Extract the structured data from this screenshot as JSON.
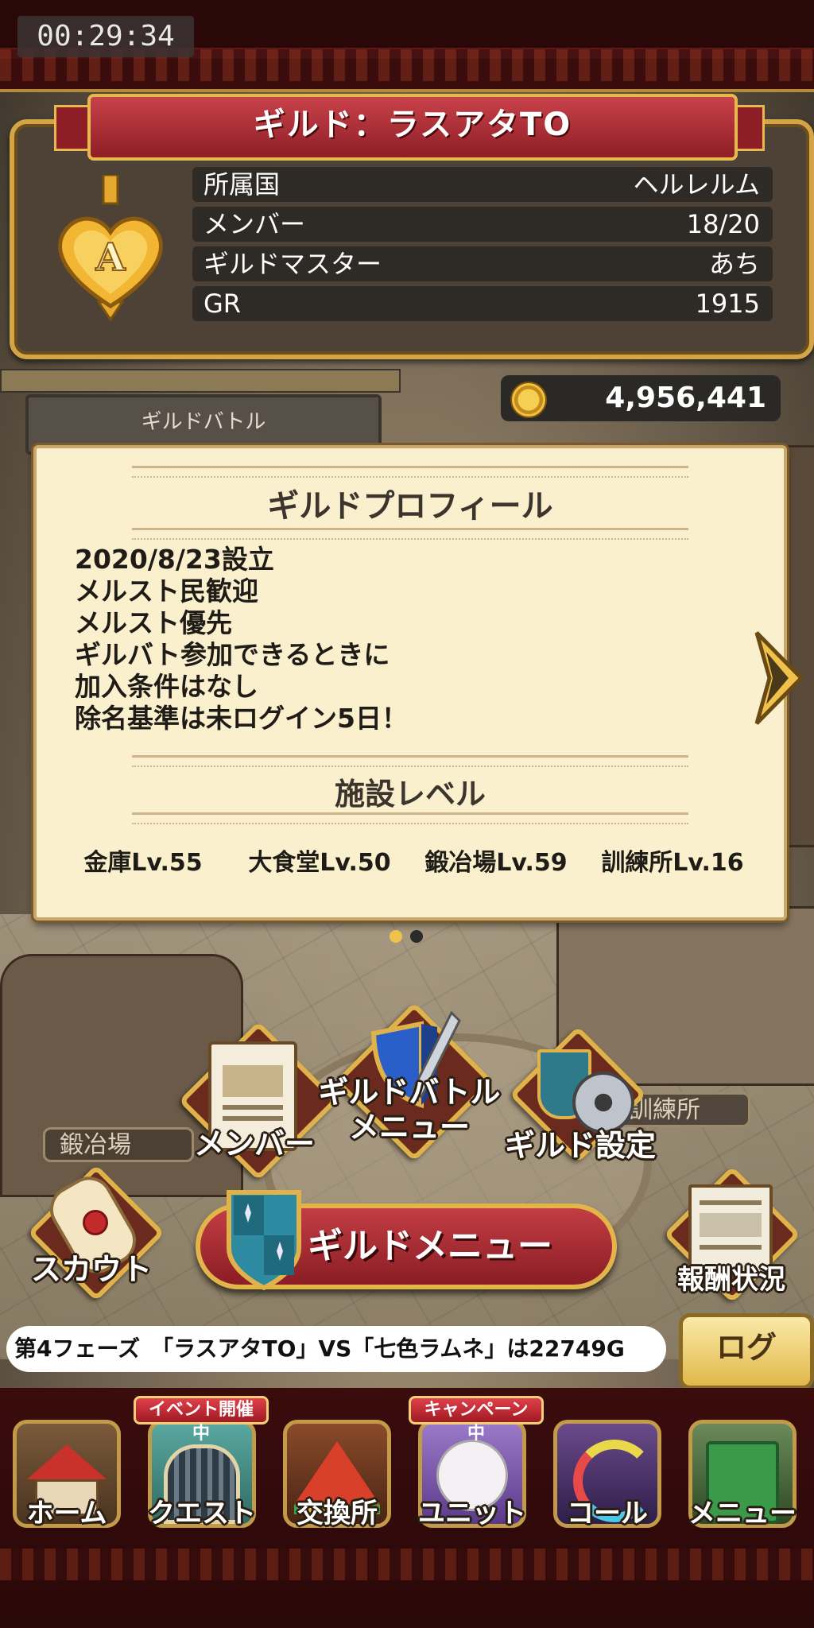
{
  "status": {
    "timer": "00:29:34"
  },
  "guild": {
    "title": "ギルド：ラスアタTO",
    "emblem_letter": "A",
    "info": [
      {
        "key": "所属国",
        "value": "ヘルレルム"
      },
      {
        "key": "メンバー",
        "value": "18/20"
      },
      {
        "key": "ギルドマスター",
        "value": "あち"
      },
      {
        "key": "GR",
        "value": "1915"
      }
    ]
  },
  "gold": "4,956,441",
  "battle_sign": "ギルドバトル",
  "profile": {
    "title": "ギルドプロフィール",
    "lines": [
      "2020/8/23設立",
      "メルスト民歓迎",
      "メルスト優先",
      "ギルバト参加できるときに",
      "加入条件はなし",
      "除名基準は未ログイン5日！"
    ],
    "facility_title": "施設レベル",
    "facilities": [
      "金庫Lv.55",
      "大食堂Lv.50",
      "鍛冶場Lv.59",
      "訓練所Lv.16"
    ]
  },
  "menu": {
    "member": "メンバー",
    "battle_menu_1": "ギルドバトル",
    "battle_menu_2": "メニュー",
    "settings": "ギルド設定",
    "scout": "スカウト",
    "guild_menu": "ギルドメニュー",
    "reward": "報酬状況",
    "place_smithy": "鍛冶場",
    "place_training": "訓練所"
  },
  "ticker": "第4フェーズ　「ラスアタTO」VS「七色ラムネ」は22749G",
  "log_button": "ログ",
  "nav": {
    "badge_event": "イベント開催中",
    "badge_campaign": "キャンペーン中",
    "items": [
      "ホーム",
      "クエスト",
      "交換所",
      "ユニット",
      "コール",
      "メニュー"
    ]
  },
  "colors": {
    "accent_red": "#a8262e",
    "gold_trim": "#d4a546",
    "card_bg": "#fbf0cd"
  }
}
